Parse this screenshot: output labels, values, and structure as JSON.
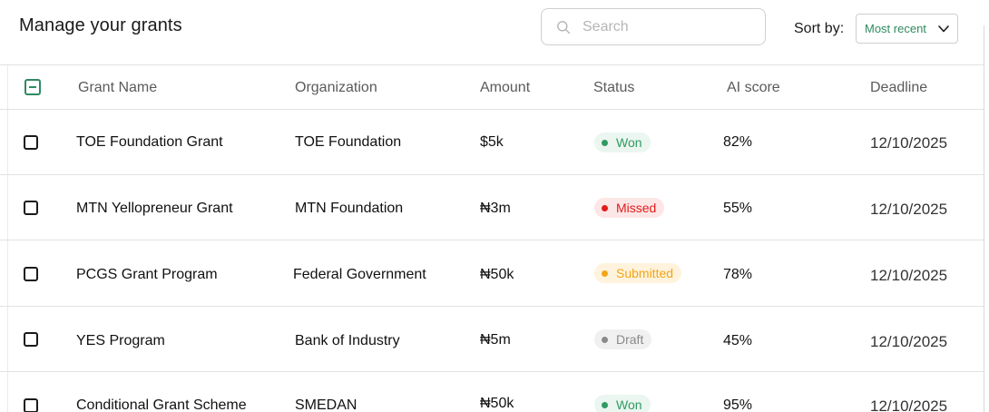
{
  "header": {
    "title": "Manage your grants",
    "search_placeholder": "Search",
    "sort_label": "Sort by:",
    "sort_value": "Most recent"
  },
  "columns": [
    "Grant Name",
    "Organization",
    "Amount",
    "Status",
    "AI score",
    "Deadline"
  ],
  "rows": [
    {
      "name": "TOE Foundation Grant",
      "org": "TOE Foundation",
      "amount": "$5k",
      "status": "Won",
      "status_type": "won",
      "score": "82%",
      "deadline": "12/10/2025"
    },
    {
      "name": "MTN Yellopreneur Grant",
      "org": "MTN Foundation",
      "amount": "₦3m",
      "status": "Missed",
      "status_type": "missed",
      "score": "55%",
      "deadline": "12/10/2025"
    },
    {
      "name": "PCGS Grant Program",
      "org": "Federal Government",
      "amount": "₦50k",
      "status": "Submitted",
      "status_type": "submitted",
      "score": "78%",
      "deadline": "12/10/2025"
    },
    {
      "name": "YES Program",
      "org": "Bank of Industry",
      "amount": "₦5m",
      "status": "Draft",
      "status_type": "draft",
      "score": "45%",
      "deadline": "12/10/2025"
    },
    {
      "name": "Conditional Grant Scheme",
      "org": "SMEDAN",
      "amount": "₦50k",
      "status": "Won",
      "status_type": "won",
      "score": "95%",
      "deadline": "12/10/2025"
    }
  ],
  "colors": {
    "accent_green": "#2f8a60",
    "won": "#2f9a62",
    "missed": "#e01b1b",
    "submitted": "#f2a516",
    "draft": "#8a8a8a"
  },
  "icons": {
    "search": "search-icon",
    "sort_dropdown": "chevron-down-icon",
    "select_all": "minus-checkbox-icon"
  }
}
